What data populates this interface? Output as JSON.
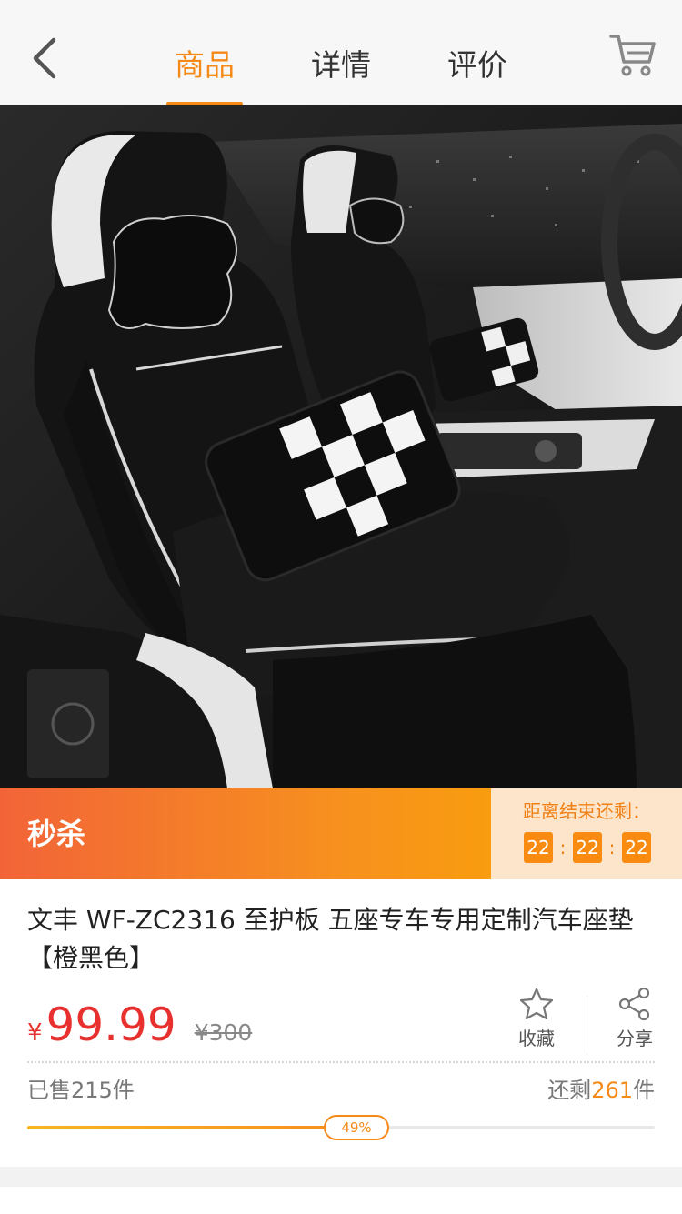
{
  "header": {
    "tabs": [
      {
        "label": "商品",
        "active": true
      },
      {
        "label": "详情",
        "active": false
      },
      {
        "label": "评价",
        "active": false
      }
    ],
    "back_icon": "chevron-left-icon",
    "cart_icon": "shopping-cart-icon"
  },
  "flash_sale": {
    "title": "秒杀",
    "countdown_label": "距离结束还剩：",
    "hours": "22",
    "minutes": "22",
    "seconds": "22",
    "separator": ":"
  },
  "product": {
    "title": "文丰 WF-ZC2316 至护板 五座专车专用定制汽车座垫【橙黑色】",
    "currency": "¥",
    "price": "99.99",
    "original_price": "¥300",
    "favorite_label": "收藏",
    "share_label": "分享",
    "sold_text": "已售215件",
    "remaining_prefix": "还剩",
    "remaining_count": "261",
    "remaining_suffix": "件",
    "progress_label": "49%",
    "progress_fraction": 0.49
  },
  "colors": {
    "accent": "#f58a18",
    "price": "#e8312e"
  }
}
